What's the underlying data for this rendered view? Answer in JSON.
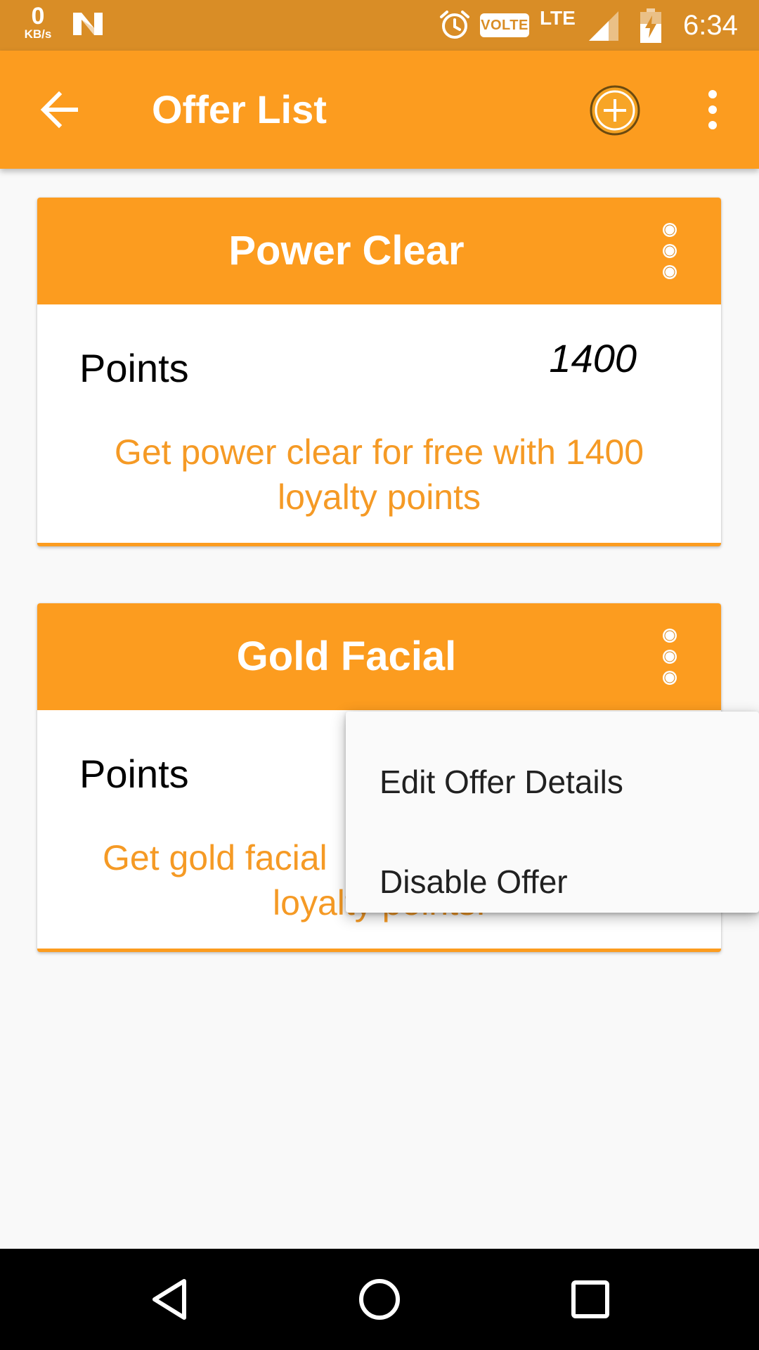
{
  "status_bar": {
    "net_speed_value": "0",
    "net_speed_unit": "KB/s",
    "volte": "VOLTE",
    "network": "LTE",
    "time": "6:34",
    "icons": [
      "n-logo-icon",
      "alarm-icon",
      "signal-icon",
      "battery-charging-icon"
    ]
  },
  "app_bar": {
    "title": "Offer List",
    "icons": [
      "back-arrow-icon",
      "add-circle-icon",
      "overflow-menu-icon"
    ]
  },
  "offers": [
    {
      "title": "Power Clear",
      "points_label": "Points",
      "points_value": "1400",
      "description": "Get power clear for free with 1400 loyalty points"
    },
    {
      "title": "Gold Facial",
      "points_label": "Points",
      "description_left": "Get gold facial",
      "description_second_line": "loyalty points."
    }
  ],
  "popup_menu": {
    "items": [
      "Edit Offer Details",
      "Disable Offer"
    ]
  },
  "nav_bar": {
    "icons": [
      "nav-back-icon",
      "nav-home-icon",
      "nav-recents-icon"
    ]
  },
  "colors": {
    "status_bar": "#d98d26",
    "primary": "#fc9c1f",
    "accent_text": "#f59a25",
    "background": "#f9f9f9"
  }
}
